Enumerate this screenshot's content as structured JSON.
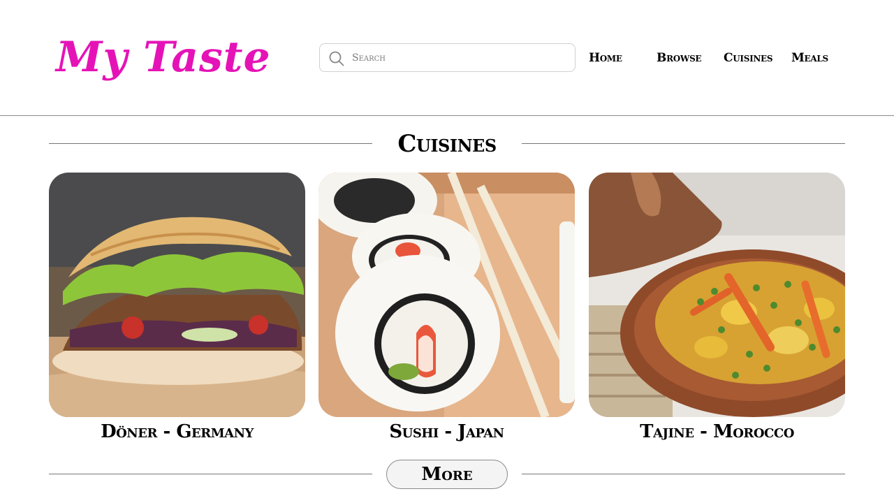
{
  "brand": {
    "logo_text": "My Taste",
    "color": "#e513b7"
  },
  "search": {
    "placeholder": "Search",
    "icon": "search-icon"
  },
  "nav": {
    "home": "Home",
    "browse": "Browse",
    "cuisines": "Cuisines",
    "meals": "Meals"
  },
  "section": {
    "title": "Cuisines"
  },
  "cards": [
    {
      "caption": "Döner - Germany",
      "image": "doner-kebab-photo"
    },
    {
      "caption": "Sushi - Japan",
      "image": "sushi-rolls-photo"
    },
    {
      "caption": "Tajine - Morocco",
      "image": "tajine-dish-photo"
    }
  ],
  "more_button": {
    "label": "More"
  }
}
